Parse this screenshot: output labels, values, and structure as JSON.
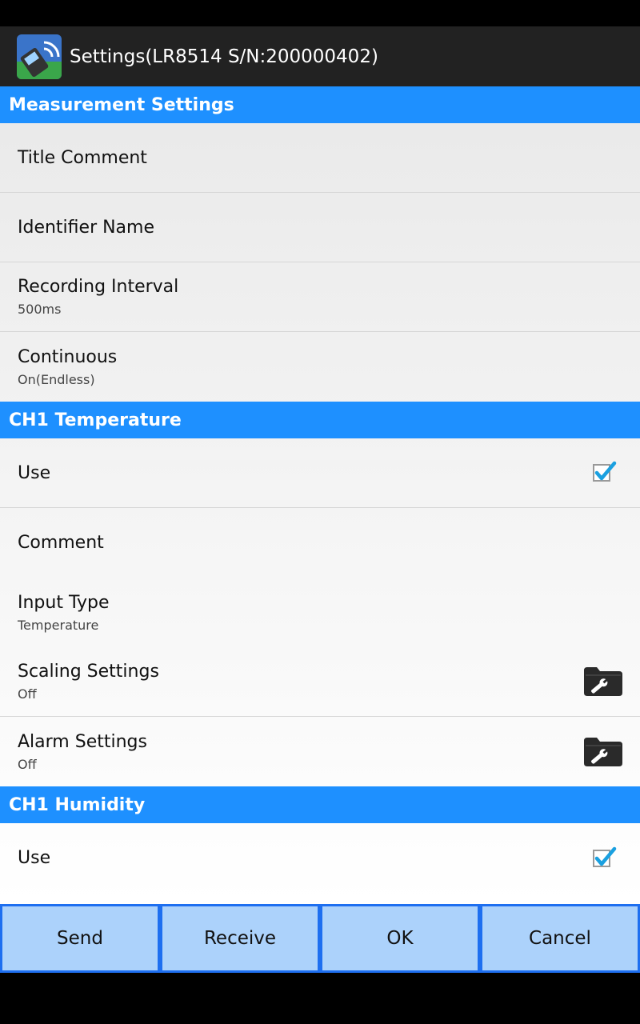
{
  "window": {
    "title": "Settings(LR8514 S/N:200000402)",
    "app_icon": "wireless-logger-icon"
  },
  "sections": [
    {
      "header": "Measurement Settings",
      "rows": [
        {
          "title": "Title Comment"
        },
        {
          "title": "Identifier Name"
        },
        {
          "title": "Recording Interval",
          "sub": "500ms"
        },
        {
          "title": "Continuous",
          "sub": "On(Endless)"
        }
      ]
    },
    {
      "header": "CH1 Temperature",
      "rows": [
        {
          "title": "Use",
          "checked": true
        },
        {
          "title": "Comment"
        },
        {
          "title": "Input Type",
          "sub": "Temperature"
        },
        {
          "title": "Scaling Settings",
          "sub": "Off",
          "icon": "wrench-folder-icon"
        },
        {
          "title": "Alarm Settings",
          "sub": "Off",
          "icon": "wrench-folder-icon"
        }
      ]
    },
    {
      "header": "CH1 Humidity",
      "rows": [
        {
          "title": "Use",
          "checked": true
        }
      ]
    }
  ],
  "buttons": {
    "send": "Send",
    "receive": "Receive",
    "ok": "OK",
    "cancel": "Cancel"
  },
  "colors": {
    "section_header": "#1e90ff",
    "button_bar": "#1e6ff0",
    "button_bg": "#acd2fb",
    "title_bar": "#222222"
  }
}
